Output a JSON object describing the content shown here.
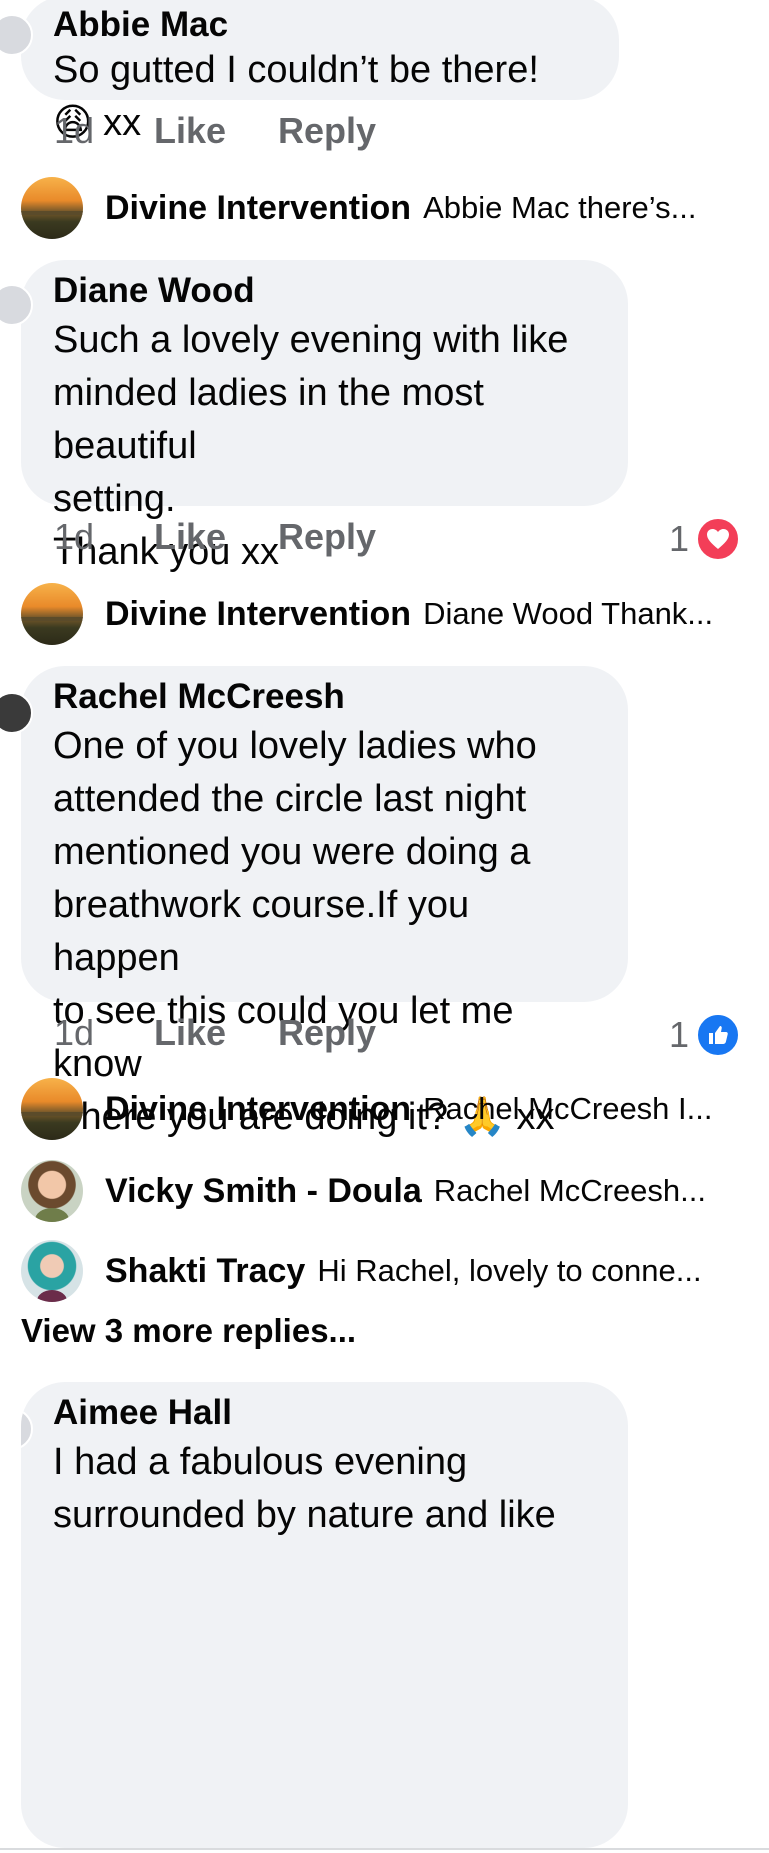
{
  "comments": [
    {
      "author": "Abbie Mac",
      "text": "So gutted I couldn’t be there! 😩 xx",
      "time": "1d",
      "like_label": "Like",
      "reply_label": "Reply"
    },
    {
      "author": "Diane Wood",
      "text": "Such a lovely evening with like\nminded ladies in the most beautiful\nsetting.\nThank you xx",
      "time": "1d",
      "like_label": "Like",
      "reply_label": "Reply",
      "reaction_count": "1",
      "reaction_icon": "heart-reaction-icon"
    },
    {
      "author": "Rachel McCreesh",
      "text": "One of you lovely ladies who\nattended the circle last night\nmentioned you were doing a\nbreathwork course.If you happen\nto see this could you let me know\nwhere you are doing it? 🙏 xx",
      "time": "1d",
      "like_label": "Like",
      "reply_label": "Reply",
      "reaction_count": "1",
      "reaction_icon": "like-reaction-icon"
    },
    {
      "author": "Aimee Hall",
      "text": "I had a fabulous evening\nsurrounded by nature and like"
    }
  ],
  "replies": [
    {
      "name": "Divine Intervention",
      "snippet": "Abbie Mac there’s..."
    },
    {
      "name": "Divine Intervention",
      "snippet": "Diane Wood Thank..."
    },
    {
      "name": "Divine Intervention",
      "snippet": "Rachel McCreesh I..."
    },
    {
      "name": "Vicky Smith - Doula",
      "snippet": "Rachel McCreesh..."
    },
    {
      "name": "Shakti Tracy",
      "snippet": "Hi Rachel, lovely to conne..."
    }
  ],
  "view_more_replies": "View 3 more replies...",
  "colors": {
    "bubble_bg": "#f0f2f5",
    "muted_text": "#65676b",
    "heart": "#f33e58",
    "like_blue": "#1877f2"
  }
}
